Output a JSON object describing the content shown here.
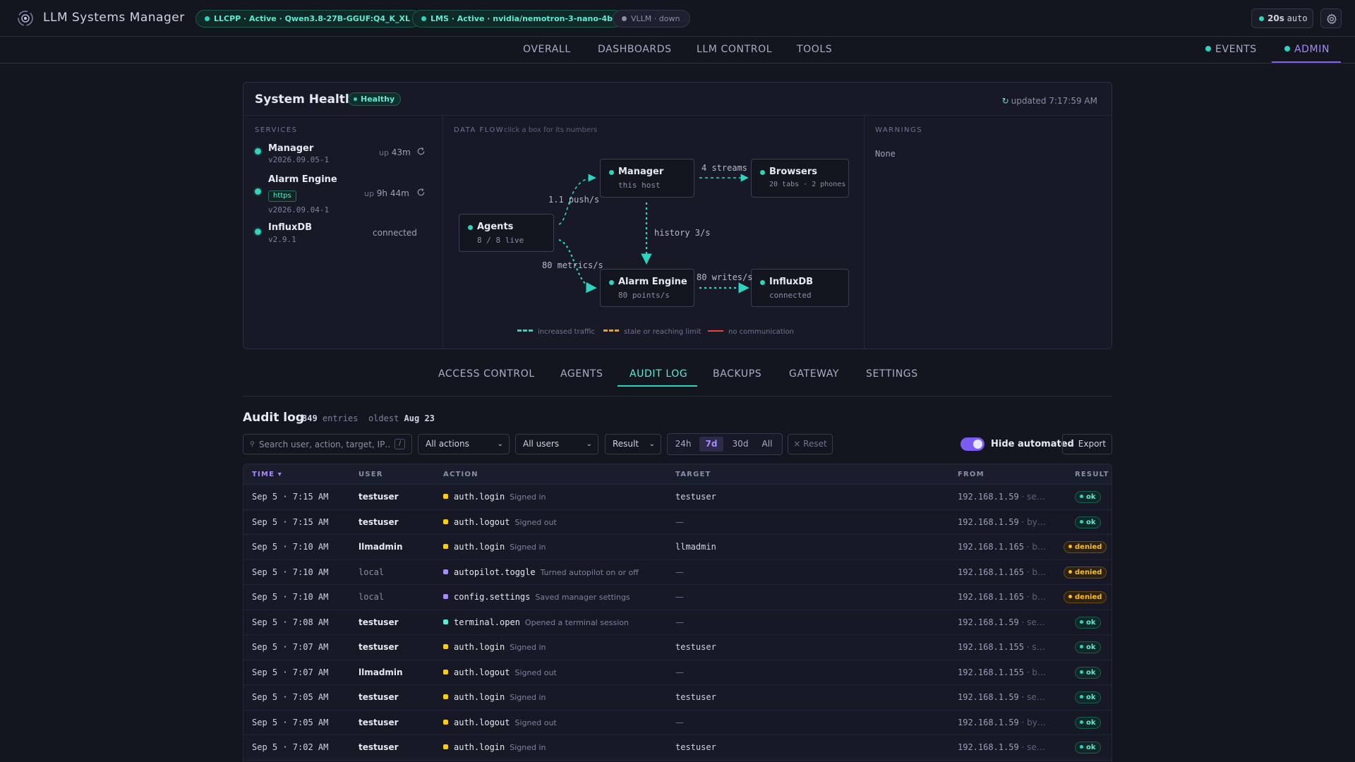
{
  "app": {
    "title": "LLM Systems Manager"
  },
  "status_pills": [
    {
      "label": "LLCPP · Active · Qwen3.8-27B-GGUF:Q4_K_XL",
      "state": "active"
    },
    {
      "label": "LMS · Active · nvidia/nemotron-3-nano-4b",
      "state": "active"
    },
    {
      "label": "VLLM · down",
      "state": "down"
    }
  ],
  "refresh": {
    "interval": "20s",
    "mode": "auto"
  },
  "nav": {
    "items": [
      "OVERALL",
      "DASHBOARDS",
      "LLM CONTROL",
      "TOOLS"
    ],
    "events": "EVENTS",
    "admin": "ADMIN",
    "active": "ADMIN"
  },
  "health": {
    "title": "System Health",
    "status": "Healthy",
    "updated": "updated 7:17:59 AM",
    "services_label": "SERVICES",
    "services": [
      {
        "name": "Manager",
        "version": "v2026.09.05-1",
        "status_prefix": "up",
        "status": "43m"
      },
      {
        "name": "Alarm Engine",
        "tag": "https",
        "version": "v2026.09.04-1",
        "status_prefix": "up",
        "status": "9h 44m"
      },
      {
        "name": "InfluxDB",
        "version": "v2.9.1",
        "status": "connected"
      }
    ],
    "flow": {
      "label": "DATA FLOW",
      "hint": "click a box for its numbers",
      "nodes": {
        "agents": {
          "name": "Agents",
          "sub": "8 / 8 live"
        },
        "manager": {
          "name": "Manager",
          "sub": "this host"
        },
        "browsers": {
          "name": "Browsers",
          "sub": "20 tabs · 2 phones"
        },
        "alarm": {
          "name": "Alarm Engine",
          "sub": "80 points/s"
        },
        "influx": {
          "name": "InfluxDB",
          "sub": "connected"
        }
      },
      "edges": {
        "push": "1.1 push/s",
        "streams": "4 streams",
        "history": "history 3/s",
        "metrics": "80 metrics/s",
        "writes": "80 writes/s"
      },
      "legend": [
        "increased traffic",
        "stale or reaching limit",
        "no communication"
      ],
      "legend_colors": [
        "#2dd4bf",
        "#f59e0b",
        "#ef4444"
      ]
    },
    "warnings_label": "WARNINGS",
    "warnings": "None"
  },
  "subtabs": {
    "items": [
      "ACCESS CONTROL",
      "AGENTS",
      "AUDIT LOG",
      "BACKUPS",
      "GATEWAY",
      "SETTINGS"
    ],
    "active": "AUDIT LOG"
  },
  "audit": {
    "title": "Audit log",
    "entries_count": "849",
    "entries_label": "entries",
    "oldest_label": "oldest",
    "oldest": "Aug 23",
    "search_placeholder": "Search user, action, target, IP…",
    "search_shortcut": "/",
    "filters": {
      "actions": "All actions",
      "users": "All users",
      "result": "Result"
    },
    "ranges": [
      "24h",
      "7d",
      "30d",
      "All"
    ],
    "active_range": "7d",
    "reset": "× Reset",
    "hide_automated": "Hide automated",
    "hide_automated_on": true,
    "export": "↓ Export",
    "columns": [
      "TIME ▾",
      "USER",
      "ACTION",
      "TARGET",
      "FROM",
      "RESULT"
    ],
    "rows": [
      {
        "time": "Sep 5 · 7:15 AM",
        "user": "testuser",
        "local": false,
        "action": "auth.login",
        "desc": "Signed in",
        "color": "#facc15",
        "target": "testuser",
        "from": "192.168.1.59",
        "from_extra": "· se…",
        "result": "ok"
      },
      {
        "time": "Sep 5 · 7:15 AM",
        "user": "testuser",
        "local": false,
        "action": "auth.logout",
        "desc": "Signed out",
        "color": "#facc15",
        "target": "—",
        "from": "192.168.1.59",
        "from_extra": "· by…",
        "result": "ok"
      },
      {
        "time": "Sep 5 · 7:10 AM",
        "user": "llmadmin",
        "local": false,
        "action": "auth.login",
        "desc": "Signed in",
        "color": "#facc15",
        "target": "llmadmin",
        "from": "192.168.1.165",
        "from_extra": "· b…",
        "result": "denied"
      },
      {
        "time": "Sep 5 · 7:10 AM",
        "user": "local",
        "local": true,
        "action": "autopilot.toggle",
        "desc": "Turned autopilot on or off",
        "color": "#a78bfa",
        "target": "—",
        "from": "192.168.1.165",
        "from_extra": "· b…",
        "result": "denied"
      },
      {
        "time": "Sep 5 · 7:10 AM",
        "user": "local",
        "local": true,
        "action": "config.settings",
        "desc": "Saved manager settings",
        "color": "#a78bfa",
        "target": "—",
        "from": "192.168.1.165",
        "from_extra": "· b…",
        "result": "denied"
      },
      {
        "time": "Sep 5 · 7:08 AM",
        "user": "testuser",
        "local": false,
        "action": "terminal.open",
        "desc": "Opened a terminal session",
        "color": "#5eead4",
        "target": "—",
        "from": "192.168.1.59",
        "from_extra": "· se…",
        "result": "ok"
      },
      {
        "time": "Sep 5 · 7:07 AM",
        "user": "testuser",
        "local": false,
        "action": "auth.login",
        "desc": "Signed in",
        "color": "#facc15",
        "target": "testuser",
        "from": "192.168.1.155",
        "from_extra": "· s…",
        "result": "ok"
      },
      {
        "time": "Sep 5 · 7:07 AM",
        "user": "llmadmin",
        "local": false,
        "action": "auth.logout",
        "desc": "Signed out",
        "color": "#facc15",
        "target": "—",
        "from": "192.168.1.155",
        "from_extra": "· b…",
        "result": "ok"
      },
      {
        "time": "Sep 5 · 7:05 AM",
        "user": "testuser",
        "local": false,
        "action": "auth.login",
        "desc": "Signed in",
        "color": "#facc15",
        "target": "testuser",
        "from": "192.168.1.59",
        "from_extra": "· se…",
        "result": "ok"
      },
      {
        "time": "Sep 5 · 7:05 AM",
        "user": "testuser",
        "local": false,
        "action": "auth.logout",
        "desc": "Signed out",
        "color": "#facc15",
        "target": "—",
        "from": "192.168.1.59",
        "from_extra": "· by…",
        "result": "ok"
      },
      {
        "time": "Sep 5 · 7:02 AM",
        "user": "testuser",
        "local": false,
        "action": "auth.login",
        "desc": "Signed in",
        "color": "#facc15",
        "target": "testuser",
        "from": "192.168.1.59",
        "from_extra": "· se…",
        "result": "ok"
      }
    ]
  }
}
